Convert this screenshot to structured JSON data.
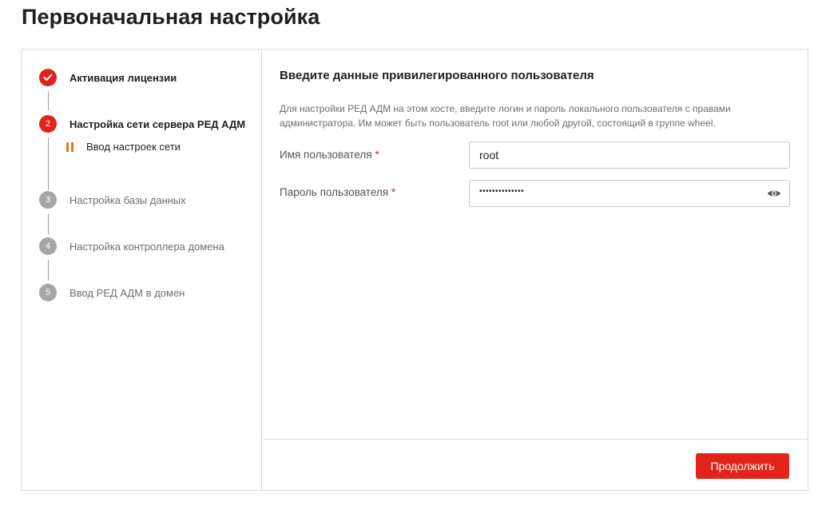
{
  "page": {
    "title": "Первоначальная настройка"
  },
  "steps": [
    {
      "number": "",
      "label": "Активация лицензии",
      "state": "done"
    },
    {
      "number": "2",
      "label": "Настройка сети сервера РЕД АДМ",
      "state": "active"
    },
    {
      "number": "3",
      "label": "Настройка базы данных",
      "state": "pending"
    },
    {
      "number": "4",
      "label": "Настройка контроллера домена",
      "state": "pending"
    },
    {
      "number": "5",
      "label": "Ввод РЕД АДМ в домен",
      "state": "pending"
    }
  ],
  "substep": {
    "label": "Ввод настроек сети",
    "icon": "pause-icon",
    "color": "#e87722"
  },
  "form": {
    "title": "Введите данные привилегированного пользователя",
    "description": "Для настройки РЕД АДМ на этом хосте, введите логин и пароль локального пользователя с правами администратора. Им может быть пользователь root или любой другой, состоящий в группе wheel.",
    "username": {
      "label": "Имя пользователя",
      "required_mark": "*",
      "value": "root"
    },
    "password": {
      "label": "Пароль пользователя",
      "required_mark": "*",
      "masked_value": "••••••••••••••",
      "toggle_icon": "eye-icon"
    }
  },
  "footer": {
    "continue_label": "Продолжить"
  },
  "colors": {
    "accent": "#e2231a",
    "in_progress": "#e87722",
    "pending": "#a6a6a6"
  }
}
